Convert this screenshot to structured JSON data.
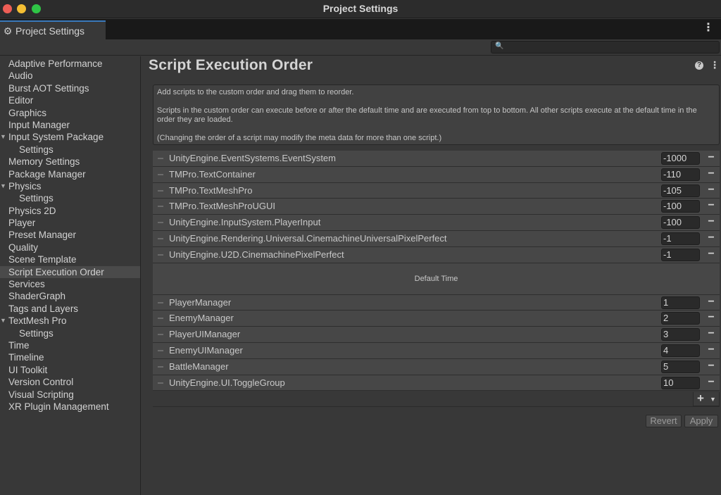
{
  "window": {
    "title": "Project Settings"
  },
  "tab": {
    "label": "Project Settings",
    "icon": "gear-icon"
  },
  "search": {
    "placeholder": ""
  },
  "sidebar": {
    "items": [
      {
        "label": "Adaptive Performance",
        "sub": false
      },
      {
        "label": "Audio",
        "sub": false
      },
      {
        "label": "Burst AOT Settings",
        "sub": false
      },
      {
        "label": "Editor",
        "sub": false
      },
      {
        "label": "Graphics",
        "sub": false
      },
      {
        "label": "Input Manager",
        "sub": false
      },
      {
        "label": "Input System Package",
        "sub": false,
        "expanded": true
      },
      {
        "label": "Settings",
        "sub": true
      },
      {
        "label": "Memory Settings",
        "sub": false
      },
      {
        "label": "Package Manager",
        "sub": false
      },
      {
        "label": "Physics",
        "sub": false,
        "expanded": true
      },
      {
        "label": "Settings",
        "sub": true
      },
      {
        "label": "Physics 2D",
        "sub": false
      },
      {
        "label": "Player",
        "sub": false
      },
      {
        "label": "Preset Manager",
        "sub": false
      },
      {
        "label": "Quality",
        "sub": false
      },
      {
        "label": "Scene Template",
        "sub": false
      },
      {
        "label": "Script Execution Order",
        "sub": false,
        "selected": true
      },
      {
        "label": "Services",
        "sub": false
      },
      {
        "label": "ShaderGraph",
        "sub": false
      },
      {
        "label": "Tags and Layers",
        "sub": false
      },
      {
        "label": "TextMesh Pro",
        "sub": false,
        "expanded": true
      },
      {
        "label": "Settings",
        "sub": true
      },
      {
        "label": "Time",
        "sub": false
      },
      {
        "label": "Timeline",
        "sub": false
      },
      {
        "label": "UI Toolkit",
        "sub": false
      },
      {
        "label": "Version Control",
        "sub": false
      },
      {
        "label": "Visual Scripting",
        "sub": false
      },
      {
        "label": "XR Plugin Management",
        "sub": false
      }
    ]
  },
  "main": {
    "title": "Script Execution Order",
    "info": {
      "line1": "Add scripts to the custom order and drag them to reorder.",
      "line2": "Scripts in the custom order can execute before or after the default time and are executed from top to bottom. All other scripts execute at the default time in the order they are loaded.",
      "line3": "(Changing the order of a script may modify the meta data for more than one script.)"
    },
    "before_default": [
      {
        "name": "UnityEngine.EventSystems.EventSystem",
        "order": "-1000"
      },
      {
        "name": "TMPro.TextContainer",
        "order": "-110"
      },
      {
        "name": "TMPro.TextMeshPro",
        "order": "-105"
      },
      {
        "name": "TMPro.TextMeshProUGUI",
        "order": "-100"
      },
      {
        "name": "UnityEngine.InputSystem.PlayerInput",
        "order": "-100"
      },
      {
        "name": "UnityEngine.Rendering.Universal.CinemachineUniversalPixelPerfect",
        "order": "-1"
      },
      {
        "name": "UnityEngine.U2D.CinemachinePixelPerfect",
        "order": "-1"
      }
    ],
    "default_time_label": "Default Time",
    "after_default": [
      {
        "name": "PlayerManager",
        "order": "1"
      },
      {
        "name": "EnemyManager",
        "order": "2"
      },
      {
        "name": "PlayerUIManager",
        "order": "3"
      },
      {
        "name": "EnemyUIManager",
        "order": "4"
      },
      {
        "name": "BattleManager",
        "order": "5"
      },
      {
        "name": "UnityEngine.UI.ToggleGroup",
        "order": "10"
      }
    ],
    "add_label": "+",
    "revert_label": "Revert",
    "apply_label": "Apply"
  },
  "colors": {
    "background": "#383838",
    "tab_accent": "#3a79bb",
    "selected_item": "#4a4a4a",
    "row": "#474747"
  }
}
